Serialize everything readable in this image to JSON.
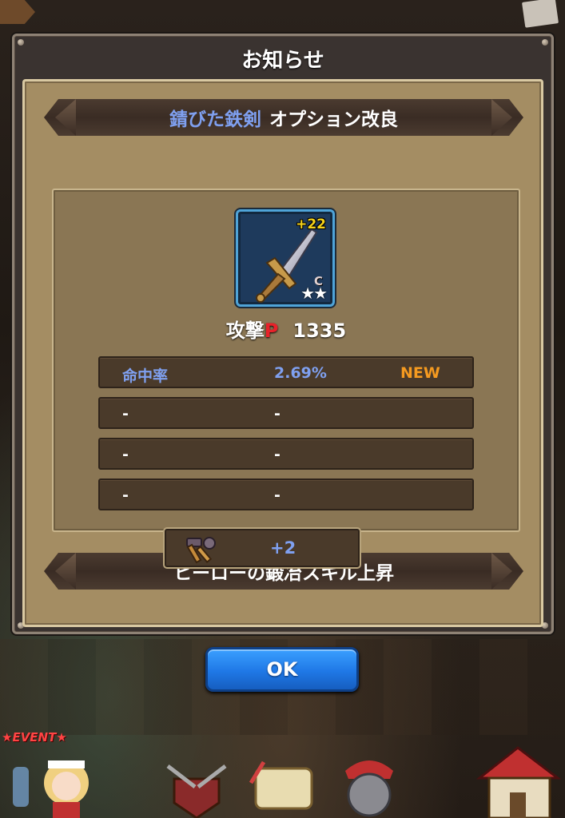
{
  "dialog": {
    "title": "お知らせ",
    "banner1": {
      "item_name": "錆びた鉄剣",
      "text": "オプション改良"
    },
    "item": {
      "enhance_level": "+22",
      "grade": "C",
      "stars": "★★",
      "attack_label": "攻撃",
      "attack_p": "P",
      "attack_value": "1335"
    },
    "options": [
      {
        "name": "命中率",
        "value": "2.69%",
        "tag": "NEW"
      },
      {
        "name": "-",
        "value": "-",
        "tag": ""
      },
      {
        "name": "-",
        "value": "-",
        "tag": ""
      },
      {
        "name": "-",
        "value": "-",
        "tag": ""
      }
    ],
    "banner2": {
      "text": "ヒーローの鍛冶スキル上昇"
    },
    "skill_value": "+2",
    "ok_label": "OK"
  },
  "background": {
    "event_label": "★EVENT★"
  },
  "colors": {
    "accent_blue": "#7fa0f0",
    "new_orange": "#f59a20",
    "attack_red": "#e8222a",
    "button_blue": "#1f78e6"
  }
}
